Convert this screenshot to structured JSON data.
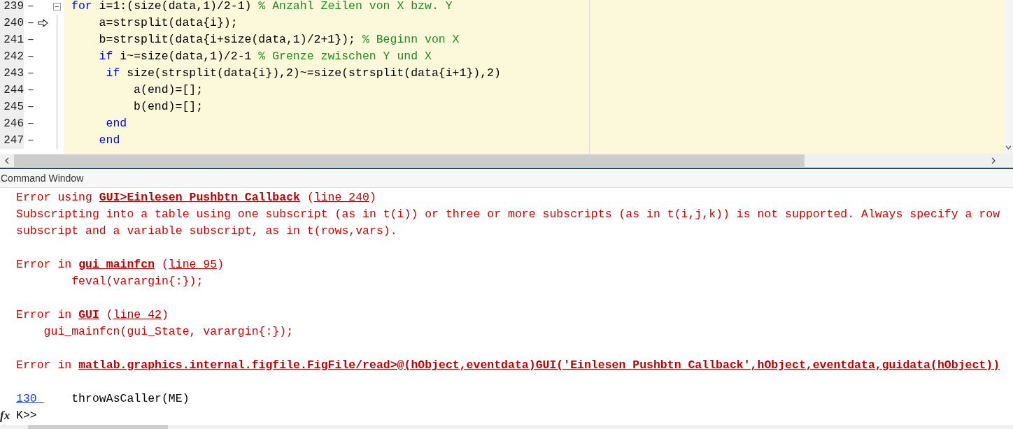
{
  "editor": {
    "lines": [
      {
        "number": "239",
        "dash": "–",
        "current": false,
        "fold": true,
        "tokens": [
          {
            "kind": "keyword",
            "text": "for"
          },
          {
            "kind": "plain",
            "text": " i=1:(size(data,1)/2-1) "
          },
          {
            "kind": "comment",
            "text": "% Anzahl Zeilen von X bzw. Y"
          }
        ]
      },
      {
        "number": "240",
        "dash": "–",
        "current": true,
        "fold": false,
        "tokens": [
          {
            "kind": "plain",
            "text": "    a=strsplit(data{i});"
          }
        ]
      },
      {
        "number": "241",
        "dash": "–",
        "current": false,
        "fold": false,
        "tokens": [
          {
            "kind": "plain",
            "text": "    b=strsplit(data{i+size(data,1)/2+1}); "
          },
          {
            "kind": "comment",
            "text": "% Beginn von X"
          }
        ]
      },
      {
        "number": "242",
        "dash": "–",
        "current": false,
        "fold": false,
        "tokens": [
          {
            "kind": "keyword",
            "text": "    if"
          },
          {
            "kind": "plain",
            "text": " i~=size(data,1)/2-1 "
          },
          {
            "kind": "comment",
            "text": "% Grenze zwischen Y und X"
          }
        ]
      },
      {
        "number": "243",
        "dash": "–",
        "current": false,
        "fold": false,
        "tokens": [
          {
            "kind": "keyword",
            "text": "     if"
          },
          {
            "kind": "plain",
            "text": " size(strsplit(data{i}),2)~=size(strsplit(data{i+1}),2)"
          }
        ]
      },
      {
        "number": "244",
        "dash": "–",
        "current": false,
        "fold": false,
        "tokens": [
          {
            "kind": "plain",
            "text": "         a(end)=[];"
          }
        ]
      },
      {
        "number": "245",
        "dash": "–",
        "current": false,
        "fold": false,
        "tokens": [
          {
            "kind": "plain",
            "text": "         b(end)=[];"
          }
        ]
      },
      {
        "number": "246",
        "dash": "–",
        "current": false,
        "fold": false,
        "tokens": [
          {
            "kind": "keyword",
            "text": "     end"
          }
        ]
      },
      {
        "number": "247",
        "dash": "–",
        "current": false,
        "fold": false,
        "tokens": [
          {
            "kind": "keyword",
            "text": "    end"
          }
        ]
      }
    ]
  },
  "command_window": {
    "title": "Command Window",
    "entries": [
      {
        "kind": "error",
        "prefix": "Error using",
        "func": "GUI>Einlesen_Pushbtn_Callback",
        "open": "(",
        "line": "line 240",
        "close": ")"
      },
      {
        "kind": "message",
        "text": "Subscripting into a table using one subscript (as in t(i)) or three or more subscripts (as in t(i,j,k)) is not supported. Always specify a row"
      },
      {
        "kind": "message",
        "text": "subscript and a variable subscript, as in t(rows,vars)."
      },
      {
        "kind": "blank"
      },
      {
        "kind": "error",
        "prefix": "Error in",
        "func": "gui_mainfcn",
        "open": "(",
        "line": "line 95",
        "close": ")"
      },
      {
        "kind": "code",
        "text": "        feval(varargin{:});"
      },
      {
        "kind": "blank"
      },
      {
        "kind": "error",
        "prefix": "Error in",
        "func": "GUI",
        "open": "(",
        "line": "line 42",
        "close": ")"
      },
      {
        "kind": "code",
        "text": "    gui_mainfcn(gui_State, varargin{:});"
      },
      {
        "kind": "blank"
      },
      {
        "kind": "error",
        "prefix": "Error in",
        "func": "matlab.graphics.internal.figfile.FigFile/read>@(hObject,eventdata)GUI('Einlesen_Pushbtn_Callback',hObject,eventdata,guidata(hObject))"
      },
      {
        "kind": "blank"
      },
      {
        "kind": "stack",
        "link": "130 ",
        "text": "    throwAsCaller(ME)"
      }
    ],
    "prompt": {
      "icon": "fx",
      "text": "K>>"
    }
  }
}
